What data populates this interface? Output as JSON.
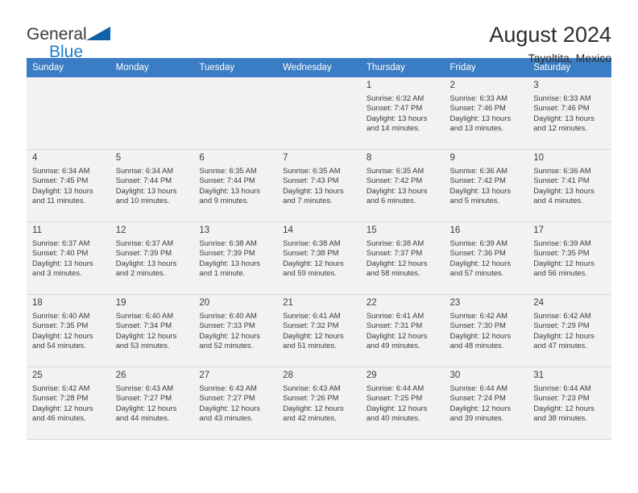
{
  "brand": {
    "name_top": "General",
    "name_bottom": "Blue",
    "mark": "triangle-logo"
  },
  "header": {
    "title": "August 2024",
    "location": "Tayoltita, Mexico"
  },
  "calendar": {
    "weekday_headers": [
      "Sunday",
      "Monday",
      "Tuesday",
      "Wednesday",
      "Thursday",
      "Friday",
      "Saturday"
    ],
    "header_bg": "#3b7dc4",
    "shaded_row_bg": "#f2f2f2",
    "weeks": [
      [
        {
          "day": "",
          "sunrise": "",
          "sunset": "",
          "daylight1": "",
          "daylight2": "",
          "empty": true
        },
        {
          "day": "",
          "sunrise": "",
          "sunset": "",
          "daylight1": "",
          "daylight2": "",
          "empty": true
        },
        {
          "day": "",
          "sunrise": "",
          "sunset": "",
          "daylight1": "",
          "daylight2": "",
          "empty": true
        },
        {
          "day": "",
          "sunrise": "",
          "sunset": "",
          "daylight1": "",
          "daylight2": "",
          "empty": true
        },
        {
          "day": "1",
          "sunrise": "Sunrise: 6:32 AM",
          "sunset": "Sunset: 7:47 PM",
          "daylight1": "Daylight: 13 hours",
          "daylight2": "and 14 minutes."
        },
        {
          "day": "2",
          "sunrise": "Sunrise: 6:33 AM",
          "sunset": "Sunset: 7:46 PM",
          "daylight1": "Daylight: 13 hours",
          "daylight2": "and 13 minutes."
        },
        {
          "day": "3",
          "sunrise": "Sunrise: 6:33 AM",
          "sunset": "Sunset: 7:46 PM",
          "daylight1": "Daylight: 13 hours",
          "daylight2": "and 12 minutes."
        }
      ],
      [
        {
          "day": "4",
          "sunrise": "Sunrise: 6:34 AM",
          "sunset": "Sunset: 7:45 PM",
          "daylight1": "Daylight: 13 hours",
          "daylight2": "and 11 minutes."
        },
        {
          "day": "5",
          "sunrise": "Sunrise: 6:34 AM",
          "sunset": "Sunset: 7:44 PM",
          "daylight1": "Daylight: 13 hours",
          "daylight2": "and 10 minutes."
        },
        {
          "day": "6",
          "sunrise": "Sunrise: 6:35 AM",
          "sunset": "Sunset: 7:44 PM",
          "daylight1": "Daylight: 13 hours",
          "daylight2": "and 9 minutes."
        },
        {
          "day": "7",
          "sunrise": "Sunrise: 6:35 AM",
          "sunset": "Sunset: 7:43 PM",
          "daylight1": "Daylight: 13 hours",
          "daylight2": "and 7 minutes."
        },
        {
          "day": "8",
          "sunrise": "Sunrise: 6:35 AM",
          "sunset": "Sunset: 7:42 PM",
          "daylight1": "Daylight: 13 hours",
          "daylight2": "and 6 minutes."
        },
        {
          "day": "9",
          "sunrise": "Sunrise: 6:36 AM",
          "sunset": "Sunset: 7:42 PM",
          "daylight1": "Daylight: 13 hours",
          "daylight2": "and 5 minutes."
        },
        {
          "day": "10",
          "sunrise": "Sunrise: 6:36 AM",
          "sunset": "Sunset: 7:41 PM",
          "daylight1": "Daylight: 13 hours",
          "daylight2": "and 4 minutes."
        }
      ],
      [
        {
          "day": "11",
          "sunrise": "Sunrise: 6:37 AM",
          "sunset": "Sunset: 7:40 PM",
          "daylight1": "Daylight: 13 hours",
          "daylight2": "and 3 minutes."
        },
        {
          "day": "12",
          "sunrise": "Sunrise: 6:37 AM",
          "sunset": "Sunset: 7:39 PM",
          "daylight1": "Daylight: 13 hours",
          "daylight2": "and 2 minutes."
        },
        {
          "day": "13",
          "sunrise": "Sunrise: 6:38 AM",
          "sunset": "Sunset: 7:39 PM",
          "daylight1": "Daylight: 13 hours",
          "daylight2": "and 1 minute."
        },
        {
          "day": "14",
          "sunrise": "Sunrise: 6:38 AM",
          "sunset": "Sunset: 7:38 PM",
          "daylight1": "Daylight: 12 hours",
          "daylight2": "and 59 minutes."
        },
        {
          "day": "15",
          "sunrise": "Sunrise: 6:38 AM",
          "sunset": "Sunset: 7:37 PM",
          "daylight1": "Daylight: 12 hours",
          "daylight2": "and 58 minutes."
        },
        {
          "day": "16",
          "sunrise": "Sunrise: 6:39 AM",
          "sunset": "Sunset: 7:36 PM",
          "daylight1": "Daylight: 12 hours",
          "daylight2": "and 57 minutes."
        },
        {
          "day": "17",
          "sunrise": "Sunrise: 6:39 AM",
          "sunset": "Sunset: 7:35 PM",
          "daylight1": "Daylight: 12 hours",
          "daylight2": "and 56 minutes."
        }
      ],
      [
        {
          "day": "18",
          "sunrise": "Sunrise: 6:40 AM",
          "sunset": "Sunset: 7:35 PM",
          "daylight1": "Daylight: 12 hours",
          "daylight2": "and 54 minutes."
        },
        {
          "day": "19",
          "sunrise": "Sunrise: 6:40 AM",
          "sunset": "Sunset: 7:34 PM",
          "daylight1": "Daylight: 12 hours",
          "daylight2": "and 53 minutes."
        },
        {
          "day": "20",
          "sunrise": "Sunrise: 6:40 AM",
          "sunset": "Sunset: 7:33 PM",
          "daylight1": "Daylight: 12 hours",
          "daylight2": "and 52 minutes."
        },
        {
          "day": "21",
          "sunrise": "Sunrise: 6:41 AM",
          "sunset": "Sunset: 7:32 PM",
          "daylight1": "Daylight: 12 hours",
          "daylight2": "and 51 minutes."
        },
        {
          "day": "22",
          "sunrise": "Sunrise: 6:41 AM",
          "sunset": "Sunset: 7:31 PM",
          "daylight1": "Daylight: 12 hours",
          "daylight2": "and 49 minutes."
        },
        {
          "day": "23",
          "sunrise": "Sunrise: 6:42 AM",
          "sunset": "Sunset: 7:30 PM",
          "daylight1": "Daylight: 12 hours",
          "daylight2": "and 48 minutes."
        },
        {
          "day": "24",
          "sunrise": "Sunrise: 6:42 AM",
          "sunset": "Sunset: 7:29 PM",
          "daylight1": "Daylight: 12 hours",
          "daylight2": "and 47 minutes."
        }
      ],
      [
        {
          "day": "25",
          "sunrise": "Sunrise: 6:42 AM",
          "sunset": "Sunset: 7:28 PM",
          "daylight1": "Daylight: 12 hours",
          "daylight2": "and 46 minutes."
        },
        {
          "day": "26",
          "sunrise": "Sunrise: 6:43 AM",
          "sunset": "Sunset: 7:27 PM",
          "daylight1": "Daylight: 12 hours",
          "daylight2": "and 44 minutes."
        },
        {
          "day": "27",
          "sunrise": "Sunrise: 6:43 AM",
          "sunset": "Sunset: 7:27 PM",
          "daylight1": "Daylight: 12 hours",
          "daylight2": "and 43 minutes."
        },
        {
          "day": "28",
          "sunrise": "Sunrise: 6:43 AM",
          "sunset": "Sunset: 7:26 PM",
          "daylight1": "Daylight: 12 hours",
          "daylight2": "and 42 minutes."
        },
        {
          "day": "29",
          "sunrise": "Sunrise: 6:44 AM",
          "sunset": "Sunset: 7:25 PM",
          "daylight1": "Daylight: 12 hours",
          "daylight2": "and 40 minutes."
        },
        {
          "day": "30",
          "sunrise": "Sunrise: 6:44 AM",
          "sunset": "Sunset: 7:24 PM",
          "daylight1": "Daylight: 12 hours",
          "daylight2": "and 39 minutes."
        },
        {
          "day": "31",
          "sunrise": "Sunrise: 6:44 AM",
          "sunset": "Sunset: 7:23 PM",
          "daylight1": "Daylight: 12 hours",
          "daylight2": "and 38 minutes."
        }
      ]
    ]
  }
}
